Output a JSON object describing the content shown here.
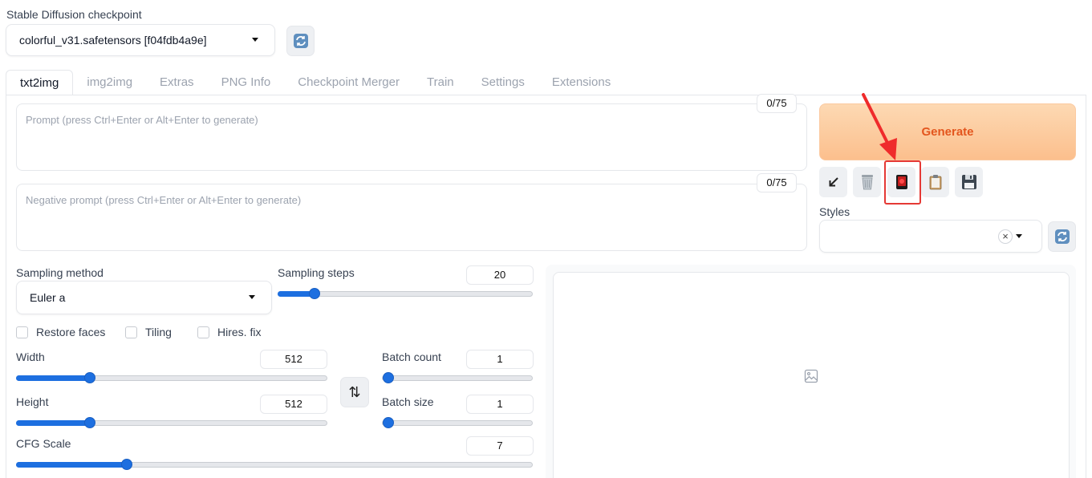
{
  "checkpoint": {
    "label": "Stable Diffusion checkpoint",
    "selected": "colorful_v31.safetensors [f04fdb4a9e]"
  },
  "tabs": [
    "txt2img",
    "img2img",
    "Extras",
    "PNG Info",
    "Checkpoint Merger",
    "Train",
    "Settings",
    "Extensions"
  ],
  "prompt": {
    "placeholder": "Prompt (press Ctrl+Enter or Alt+Enter to generate)",
    "counter": "0/75"
  },
  "negative_prompt": {
    "placeholder": "Negative prompt (press Ctrl+Enter or Alt+Enter to generate)",
    "counter": "0/75"
  },
  "generate_label": "Generate",
  "styles": {
    "label": "Styles",
    "clear": "×"
  },
  "sampling": {
    "method_label": "Sampling method",
    "method_value": "Euler a",
    "steps_label": "Sampling steps",
    "steps_value": "20"
  },
  "checks": {
    "restore_faces": "Restore faces",
    "tiling": "Tiling",
    "hires_fix": "Hires. fix"
  },
  "width": {
    "label": "Width",
    "value": "512"
  },
  "height": {
    "label": "Height",
    "value": "512"
  },
  "batch_count": {
    "label": "Batch count",
    "value": "1"
  },
  "batch_size": {
    "label": "Batch size",
    "value": "1"
  },
  "cfg": {
    "label": "CFG Scale",
    "value": "7"
  },
  "swap_label": "⇅",
  "colors": {
    "accent": "#1d6fe0",
    "generate_text": "#e3561e",
    "highlight": "#e53935"
  }
}
